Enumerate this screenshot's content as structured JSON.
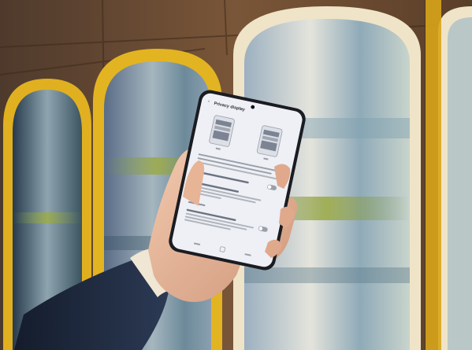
{
  "photo": {
    "subject": "hand-holding-smartphone",
    "colors": {
      "wall_wood": "#6b4a2e",
      "arch_frame": "#e2b21c",
      "arch_frame_light": "#f0e6cf",
      "sleeve_navy": "#1f2a3f",
      "skin": "#e8b89a",
      "phone_body": "#1b1c22",
      "screen_bg": "#eef0f5",
      "toggle_gray": "#9aa0aa"
    }
  },
  "screen": {
    "back_glyph": "‹",
    "title": "Privacy display"
  }
}
